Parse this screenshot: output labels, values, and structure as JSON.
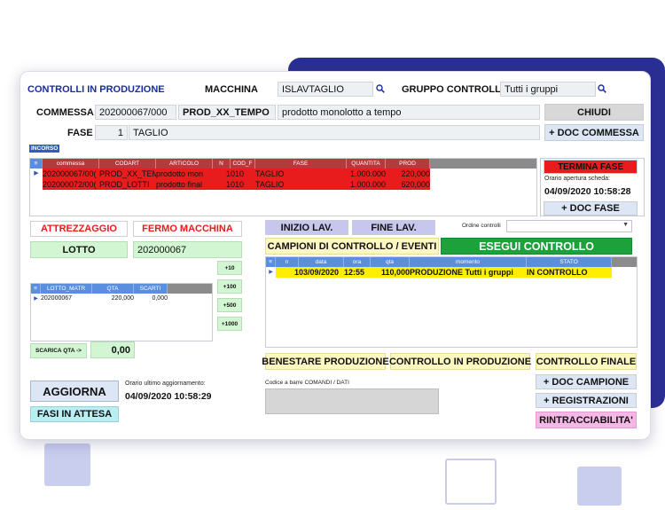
{
  "header": {
    "title": "CONTROLLI IN PRODUZIONE",
    "macchina_label": "MACCHINA",
    "macchina_value": "ISLAVTAGLIO",
    "gruppo_label": "GRUPPO CONTROLLI",
    "gruppo_value": "Tutti i gruppi",
    "commessa_label": "COMMESSA",
    "commessa_value": "202000067/000",
    "prod_code": "PROD_XX_TEMPO",
    "prod_desc": "prodotto monolotto a tempo",
    "chiudi": "CHIUDI",
    "fase_label": "FASE",
    "fase_num": "1",
    "fase_value": "TAGLIO",
    "doc_commessa": "+ DOC COMMESSA",
    "incorso": "INCORSO"
  },
  "fasi_grid": {
    "columns": [
      "commessa",
      "CODART",
      "ARTICOLO",
      "N",
      "COD_F",
      "FASE",
      "QUANTITA",
      "PROD"
    ],
    "rows": [
      {
        "commessa": "202000067/00(",
        "codart": "PROD_XX_TEM",
        "articolo": "prodotto mon",
        "n": "1",
        "codf": "010",
        "fase": "TAGLIO",
        "quantita": "1.000.000",
        "prod": "220,000"
      },
      {
        "commessa": "202000072/00(",
        "codart": "PROD_LOTTI",
        "articolo": "prodotto final",
        "n": "1",
        "codf": "010",
        "fase": "TAGLIO",
        "quantita": "1.000.000",
        "prod": "620,000"
      }
    ]
  },
  "fase_side": {
    "termina": "TERMINA FASE",
    "orario_label": "Orario apertura scheda:",
    "orario_value": "04/09/2020 10:58:28",
    "doc_fase": "+ DOC FASE"
  },
  "left": {
    "attrezzaggio": "ATTREZZAGGIO",
    "fermo": "FERMO MACCHINA",
    "lotto_label": "LOTTO",
    "lotto_value": "202000067",
    "lotti_columns": [
      "LOTTO_MATR",
      "QTA",
      "SCARTI"
    ],
    "lotti_rows": [
      {
        "lotto": "202000067",
        "qta": "220,000",
        "scarti": "0,000"
      }
    ],
    "inc": [
      "+10",
      "+100",
      "+500",
      "+1000"
    ],
    "scarica_label": "SCARICA QTA ->",
    "scarica_value": "0,00",
    "aggiorna": "AGGIORNA",
    "fasi_attesa": "FASI IN ATTESA",
    "orario_label": "Orario ultimo aggiornamento:",
    "orario_value": "04/09/2020 10:58:29"
  },
  "controls": {
    "inizio": "INIZIO LAV.",
    "fine": "FINE LAV.",
    "ordine_label": "Ordine controlli",
    "ordine_value": "",
    "campioni": "CAMPIONI DI CONTROLLO / EVENTI",
    "esegui": "ESEGUI CONTROLLO",
    "grid_columns": [
      "n",
      "data",
      "ora",
      "qta",
      "momento",
      "STATO"
    ],
    "grid_rows": [
      {
        "n": "1",
        "data": "03/09/2020",
        "ora": "12:55",
        "qta": "110,000",
        "momento": "PRODUZIONE Tutti i gruppi",
        "stato": "IN CONTROLLO"
      }
    ],
    "benestare": "BENESTARE PRODUZIONE",
    "controllo_prod": "CONTROLLO IN PRODUZIONE",
    "controllo_finale": "CONTROLLO FINALE",
    "barcode_label": "Codice a barre COMANDI / DATI",
    "barcode_value": "",
    "doc_campione": "+ DOC CAMPIONE",
    "registrazioni": "+ REGISTRAZIONI",
    "rintracciabilita": "RINTRACCIABILITA'"
  },
  "colors": {
    "navy_deco": "#2a2f94",
    "title_blue": "#1b2d9c",
    "red": "#e81c1c",
    "green": "#1da13a",
    "yellow_row": "#ffee00"
  }
}
